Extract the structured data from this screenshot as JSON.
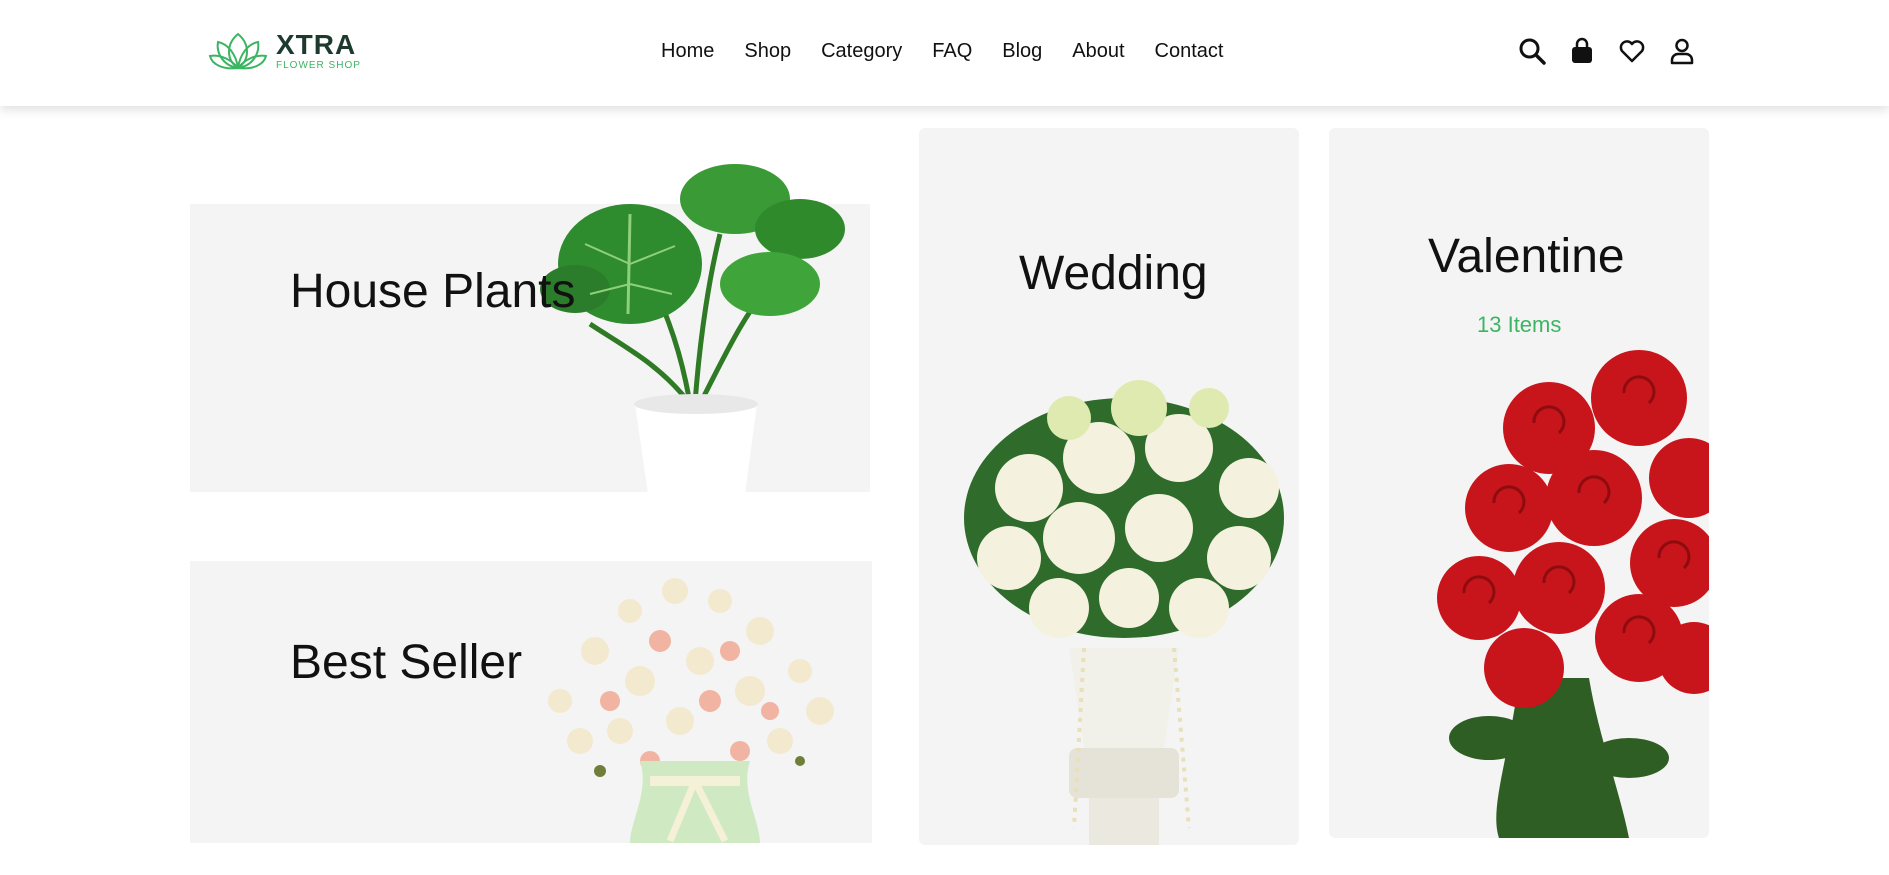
{
  "brand": {
    "name": "XTRA",
    "tagline": "FLOWER SHOP",
    "accent": "#3cb563"
  },
  "nav": {
    "items": [
      "Home",
      "Shop",
      "Category",
      "FAQ",
      "Blog",
      "About",
      "Contact"
    ]
  },
  "header_icons": [
    "search-icon",
    "shopping-bag-icon",
    "heart-icon",
    "user-icon"
  ],
  "categories": {
    "house_plants": {
      "title": "House Plants"
    },
    "best_seller": {
      "title": "Best Seller"
    },
    "wedding": {
      "title": "Wedding"
    },
    "valentine": {
      "title": "Valentine",
      "count": "13 Items"
    }
  }
}
